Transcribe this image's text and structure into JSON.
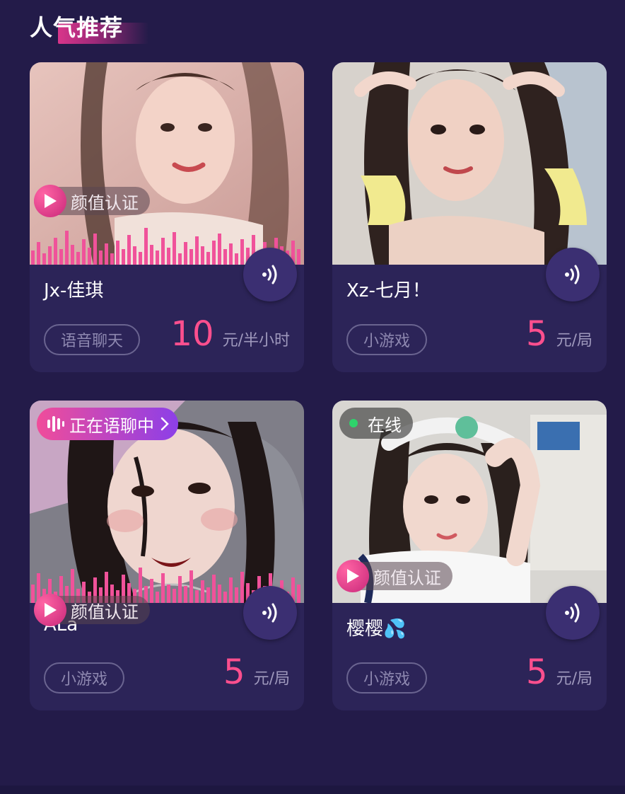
{
  "section": {
    "title": "人气推荐"
  },
  "cards": [
    {
      "name": "Jx-佳琪",
      "tag": "语音聊天",
      "price": "10",
      "unit": "元/半小时",
      "verify_label": "颜值认证",
      "status_badge": ""
    },
    {
      "name": "Xz-七月！",
      "tag": "小游戏",
      "price": "5",
      "unit": "元/局",
      "verify_label": "",
      "status_badge": ""
    },
    {
      "name": "ALa",
      "tag": "小游戏",
      "price": "5",
      "unit": "元/局",
      "verify_label": "颜值认证",
      "status_badge": "正在语聊中"
    },
    {
      "name": "樱樱💦",
      "tag": "小游戏",
      "price": "5",
      "unit": "元/局",
      "verify_label": "颜值认证",
      "status_badge": "在线"
    }
  ],
  "colors": {
    "background": "#231b49",
    "card": "#2c2458",
    "price": "#ff4f8e",
    "accent_gradient_start": "#f04d9a",
    "accent_gradient_end": "#8c3fe8",
    "online_dot": "#2ed36b"
  },
  "icons": [
    "play-icon",
    "voice-icon",
    "audio-bars-icon",
    "chevron-right-icon",
    "online-dot-icon"
  ]
}
